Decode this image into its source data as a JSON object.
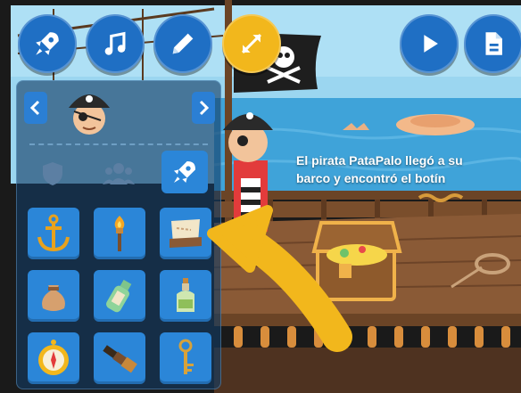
{
  "colors": {
    "toolbar_blue": "#1f6fc4",
    "accent_yellow": "#f2b71c",
    "panel_bg": "#1d4f80",
    "item_blue": "#2b86d8",
    "sky": "#9bd6f0",
    "sea": "#3fa3d9",
    "deck": "#8a5a36"
  },
  "toolbar": {
    "left_buttons": [
      "rocket-icon",
      "music-note-icon",
      "pencil-icon",
      "expand-arrows-icon"
    ],
    "right_buttons": [
      "play-icon",
      "document-icon"
    ]
  },
  "panel": {
    "prev": "chevron-left-icon",
    "next": "chevron-right-icon",
    "categories": [
      "shield-icon",
      "group-icon",
      "rocket-icon"
    ],
    "items": [
      "anchor-icon",
      "torch-icon",
      "treasure-map-icon",
      "money-bag-icon",
      "message-bottle-icon",
      "rum-bottle-icon",
      "compass-icon",
      "spyglass-icon",
      "key-icon"
    ]
  },
  "story": {
    "line1": "El pirata PataPalo llegó a su",
    "line2": "barco y encontró el botín"
  }
}
